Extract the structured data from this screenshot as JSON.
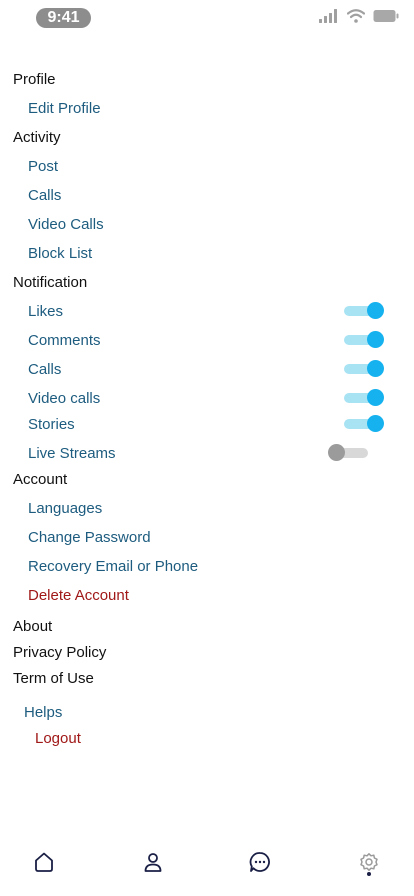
{
  "status_bar": {
    "time": "9:41",
    "icons": [
      "signal-icon",
      "wifi-icon",
      "battery-icon"
    ]
  },
  "colors": {
    "section_text": "#111111",
    "item_text": "#1d5c7f",
    "danger_text": "#a01818",
    "toggle_on_track": "#a8e3f3",
    "toggle_on_knob": "#16b2ef",
    "toggle_off_knob": "#9b9b9b",
    "nav_active": "#1a1f45",
    "nav_inactive": "#9a9a9a"
  },
  "settings": {
    "profile": {
      "title": "Profile",
      "edit_profile": "Edit Profile"
    },
    "activity": {
      "title": "Activity",
      "post": "Post",
      "calls": "Calls",
      "video_calls": "Video Calls",
      "block_list": "Block List"
    },
    "notification": {
      "title": "Notification",
      "likes": {
        "label": "Likes",
        "enabled": true
      },
      "comments": {
        "label": "Comments",
        "enabled": true
      },
      "calls": {
        "label": "Calls",
        "enabled": true
      },
      "video_calls": {
        "label": "Video calls",
        "enabled": true
      },
      "stories": {
        "label": "Stories",
        "enabled": true
      },
      "live_streams": {
        "label": "Live Streams",
        "enabled": false
      }
    },
    "account": {
      "title": "Account",
      "languages": "Languages",
      "change_password": "Change Password",
      "recovery": "Recovery Email or Phone",
      "delete_account": "Delete Account"
    },
    "about": "About",
    "privacy_policy": "Privacy Policy",
    "terms": "Term of Use",
    "helps": "Helps",
    "logout": "Logout"
  },
  "bottom_nav": {
    "items": [
      "home-icon",
      "profile-icon",
      "chat-icon",
      "settings-icon"
    ],
    "active": "settings-icon"
  }
}
